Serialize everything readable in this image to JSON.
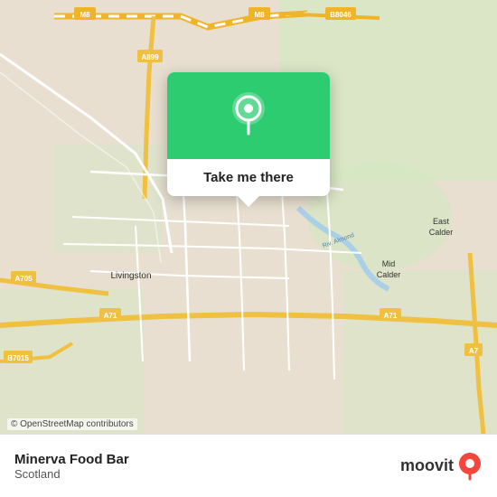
{
  "map": {
    "background_color": "#e8e0d8",
    "center_lat": 55.88,
    "center_lng": -3.52,
    "attribution": "© OpenStreetMap contributors"
  },
  "popup": {
    "take_me_label": "Take me there",
    "pin_color": "#ffffff"
  },
  "info_bar": {
    "location_name": "Minerva Food Bar",
    "location_region": "Scotland",
    "logo_text": "moovit"
  },
  "roads": {
    "motorway_color": "#f6c94a",
    "a_road_color": "#f0c040",
    "local_road_color": "#ffffff",
    "green_area_color": "#c8e6c0"
  }
}
